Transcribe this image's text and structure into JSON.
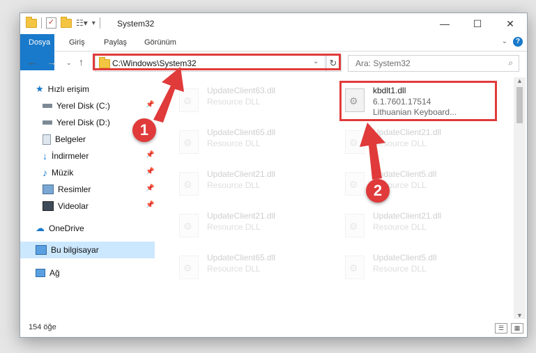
{
  "window": {
    "title": "System32"
  },
  "title_buttons": {
    "minimize": "—",
    "maximize": "☐",
    "close": "✕"
  },
  "ribbon": {
    "tabs": [
      "Dosya",
      "Giriş",
      "Paylaş",
      "Görünüm"
    ],
    "help": "?"
  },
  "address": {
    "path": "C:\\Windows\\System32"
  },
  "search": {
    "placeholder": "Ara: System32"
  },
  "sidebar": {
    "items": [
      {
        "label": "Hızlı erişim",
        "icon": "star-icon"
      },
      {
        "label": "Yerel Disk (C:)",
        "icon": "drive-icon",
        "pinned": true
      },
      {
        "label": "Yerel Disk (D:)",
        "icon": "drive-icon"
      },
      {
        "label": "Belgeler",
        "icon": "documents-icon"
      },
      {
        "label": "İndirmeler",
        "icon": "download-icon",
        "pinned": true
      },
      {
        "label": "Müzik",
        "icon": "music-icon",
        "pinned": true
      },
      {
        "label": "Resimler",
        "icon": "pictures-icon",
        "pinned": true
      },
      {
        "label": "Videolar",
        "icon": "videos-icon",
        "pinned": true
      },
      {
        "label": "OneDrive",
        "icon": "cloud-icon"
      },
      {
        "label": "Bu bilgisayar",
        "icon": "computer-icon",
        "selected": true
      },
      {
        "label": "Ağ",
        "icon": "network-icon"
      }
    ]
  },
  "files": {
    "highlighted": {
      "name": "kbdlt1.dll",
      "version": "6.1.7601.17514",
      "description": "Lithuanian Keyboard..."
    },
    "background": [
      {
        "name": "UpdateClient63.dll",
        "type": "Resource DLL"
      },
      {
        "name": "UpdateClient65.dll",
        "type": "Resource DLL"
      },
      {
        "name": "UpdateClient21.dll",
        "type": "Resource DLL"
      },
      {
        "name": "UpdateClient21.dll",
        "type": "Resource DLL"
      },
      {
        "name": "UpdateClient5.dll",
        "type": "Resource DLL"
      },
      {
        "name": "UpdateClient21.dll",
        "type": "Resource DLL"
      },
      {
        "name": "UpdateClient21.dll",
        "type": "Resource DLL"
      },
      {
        "name": "UpdateClient65.dll",
        "type": "Resource DLL"
      },
      {
        "name": "UpdateClient5.dll",
        "type": "Resource DLL"
      }
    ]
  },
  "status": {
    "count": "154 öğe"
  },
  "annotations": {
    "badge1": "1",
    "badge2": "2",
    "color": "#e03a3a"
  },
  "colors": {
    "accent": "#1979ca",
    "selection": "#cce8ff"
  }
}
